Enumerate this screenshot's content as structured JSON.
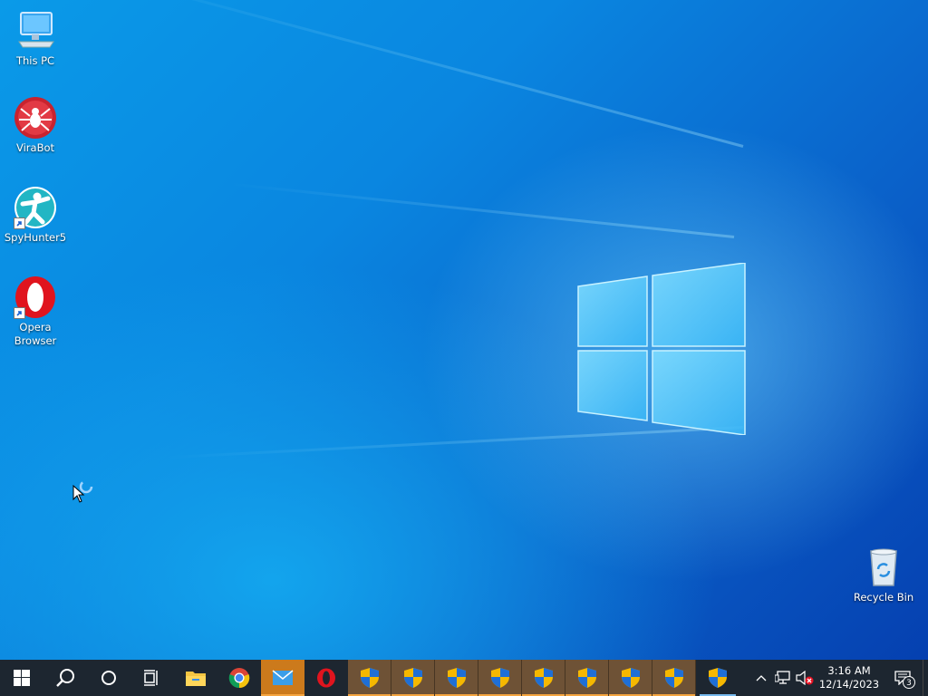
{
  "desktop": {
    "icons": [
      {
        "label": "This PC",
        "icon": "this-pc-icon"
      },
      {
        "label": "ViraBot",
        "icon": "virabot-spider-icon"
      },
      {
        "label": "SpyHunter5",
        "icon": "spyhunter-icon"
      },
      {
        "label": "Opera Browser",
        "icon": "opera-icon"
      },
      {
        "label": "Recycle Bin",
        "icon": "recycle-bin-icon"
      }
    ]
  },
  "taskbar": {
    "start": {
      "icon": "windows-start-icon"
    },
    "search": {
      "icon": "search-icon"
    },
    "cortana": {
      "icon": "cortana-circle-icon"
    },
    "task_view": {
      "icon": "task-view-icon"
    },
    "pinned": [
      {
        "name": "File Explorer",
        "icon": "file-explorer-icon"
      },
      {
        "name": "Google Chrome",
        "icon": "chrome-icon"
      },
      {
        "name": "Mail",
        "icon": "mail-icon",
        "state": "flashing"
      },
      {
        "name": "Opera",
        "icon": "opera-icon"
      }
    ],
    "uac_windows_count": 8,
    "active_uac": {
      "icon": "uac-shield-icon"
    },
    "tray": {
      "chevron": "chevron-up-icon",
      "network": "network-icon",
      "volume": "volume-muted-icon"
    },
    "clock": {
      "time": "3:16 AM",
      "date": "12/14/2023"
    },
    "notifications": {
      "count": "3"
    }
  },
  "colors": {
    "taskbar_bg": "#1d2630",
    "flash_orange": "#cc7a1c",
    "flash_dim": "#6e5236",
    "desktop_blue": "#0a86e0"
  }
}
